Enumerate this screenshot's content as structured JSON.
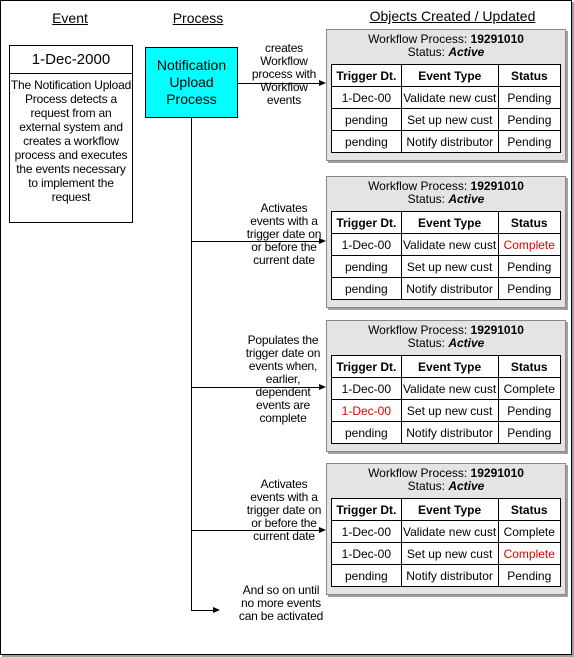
{
  "headers": {
    "event": "Event",
    "process": "Process",
    "objects": "Objects Created / Updated"
  },
  "event": {
    "date": "1-Dec-2000",
    "description": "The Notification Upload Process detects a request from an external system and creates a workflow process and executes the events necessary to implement the request"
  },
  "process": {
    "name": "Notification Upload Process"
  },
  "steps": [
    {
      "label": "creates Workflow process with Workflow events"
    },
    {
      "label": "Activates events with a trigger date on or before the current date"
    },
    {
      "label": "Populates the trigger date on events when, earlier, dependent events are complete"
    },
    {
      "label": "Activates events with a trigger date on or before the current date"
    },
    {
      "label": "And so on until no more events can be activated"
    }
  ],
  "workflow": {
    "process_label": "Workflow Process:",
    "process_id": "19291010",
    "status_label": "Status:",
    "status_value": "Active",
    "columns": [
      "Trigger Dt.",
      "Event Type",
      "Status"
    ],
    "highlight_color": "#e00000"
  },
  "snapshots": [
    {
      "rows": [
        {
          "trigger": "1-Dec-00",
          "type": "Validate new cust",
          "status": "Pending",
          "highlight": []
        },
        {
          "trigger": "pending",
          "type": "Set up new cust",
          "status": "Pending",
          "highlight": []
        },
        {
          "trigger": "pending",
          "type": "Notify distributor",
          "status": "Pending",
          "highlight": []
        }
      ]
    },
    {
      "rows": [
        {
          "trigger": "1-Dec-00",
          "type": "Validate new cust",
          "status": "Complete",
          "highlight": [
            "status"
          ]
        },
        {
          "trigger": "pending",
          "type": "Set up new cust",
          "status": "Pending",
          "highlight": []
        },
        {
          "trigger": "pending",
          "type": "Notify distributor",
          "status": "Pending",
          "highlight": []
        }
      ]
    },
    {
      "rows": [
        {
          "trigger": "1-Dec-00",
          "type": "Validate new cust",
          "status": "Complete",
          "highlight": []
        },
        {
          "trigger": "1-Dec-00",
          "type": "Set up new cust",
          "status": "Pending",
          "highlight": [
            "trigger"
          ]
        },
        {
          "trigger": "pending",
          "type": "Notify distributor",
          "status": "Pending",
          "highlight": []
        }
      ]
    },
    {
      "rows": [
        {
          "trigger": "1-Dec-00",
          "type": "Validate new cust",
          "status": "Complete",
          "highlight": []
        },
        {
          "trigger": "1-Dec-00",
          "type": "Set up new cust",
          "status": "Complete",
          "highlight": [
            "status"
          ]
        },
        {
          "trigger": "pending",
          "type": "Notify distributor",
          "status": "Pending",
          "highlight": []
        }
      ]
    }
  ]
}
